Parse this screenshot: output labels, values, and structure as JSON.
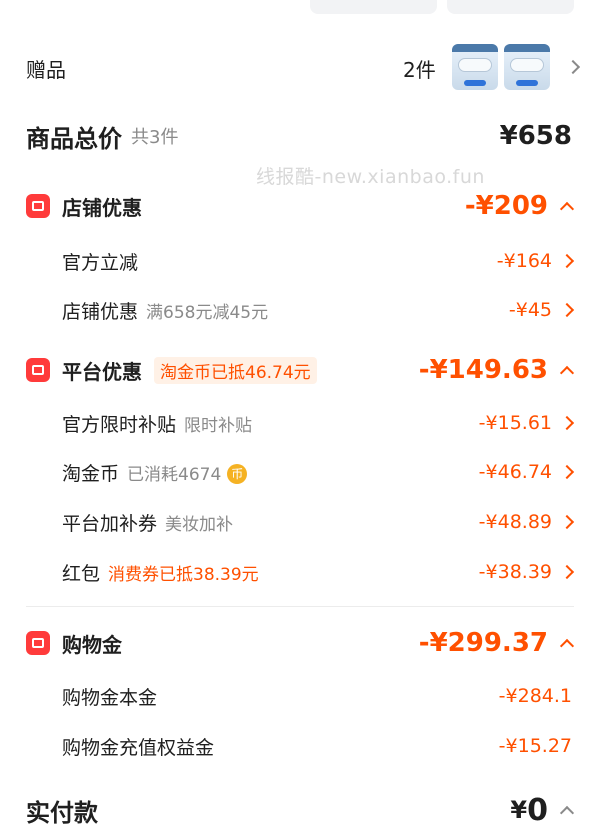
{
  "gift": {
    "label": "赠品",
    "count": "2件"
  },
  "total": {
    "title": "商品总价",
    "sub": "共3件",
    "value": "¥658"
  },
  "watermark": "线报酷-new.xianbao.fun",
  "store": {
    "title": "店铺优惠",
    "value": "-¥209",
    "items": [
      {
        "label": "官方立减",
        "note": "",
        "value": "-¥164"
      },
      {
        "label": "店铺优惠",
        "note": "满658元减45元",
        "value": "-¥45"
      }
    ]
  },
  "platform": {
    "title": "平台优惠",
    "badge": "淘金币已抵46.74元",
    "value": "-¥149.63",
    "items": [
      {
        "label": "官方限时补贴",
        "note": "限时补贴",
        "value": "-¥15.61"
      },
      {
        "label": "淘金币",
        "note": "已消耗4674",
        "value": "-¥46.74"
      },
      {
        "label": "平台加补券",
        "note": "美妆加补",
        "value": "-¥48.89"
      },
      {
        "label": "红包",
        "note": "消费券已抵38.39元",
        "value": "-¥38.39"
      }
    ]
  },
  "shopping": {
    "title": "购物金",
    "value": "-¥299.37",
    "items": [
      {
        "label": "购物金本金",
        "value": "-¥284.1"
      },
      {
        "label": "购物金充值权益金",
        "value": "-¥15.27"
      }
    ]
  },
  "pay": {
    "title": "实付款",
    "currency": "¥",
    "value": "0"
  },
  "colors": {
    "accent": "#ff5000",
    "icon_red": "#ff3b3b",
    "muted": "#8a8a8a"
  }
}
